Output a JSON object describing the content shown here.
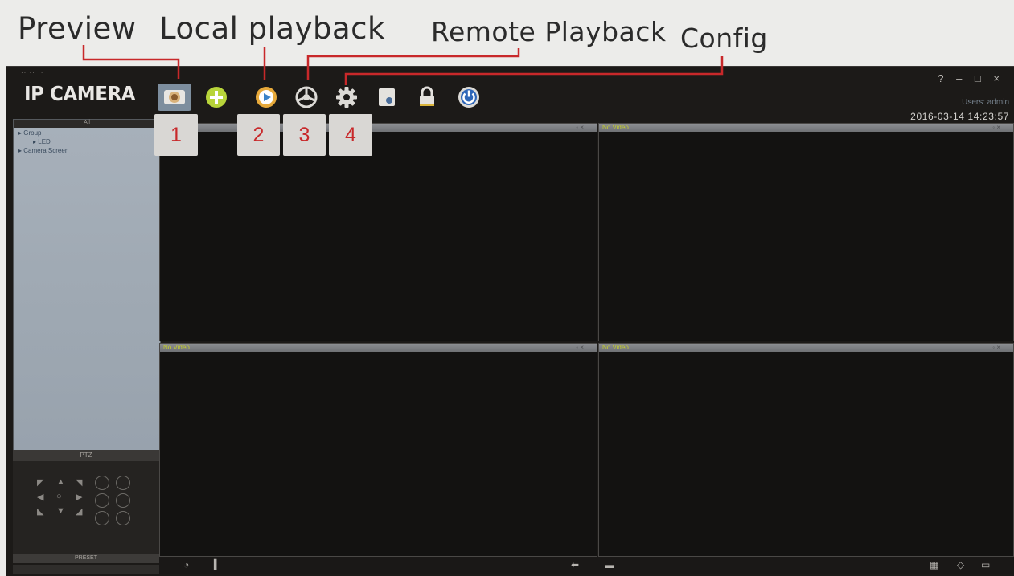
{
  "annotations": {
    "preview": "Preview",
    "local_playback": "Local playback",
    "remote_playback": "Remote Playback",
    "config": "Config"
  },
  "app": {
    "logo": "IP CAMERA",
    "datetime": "2016-03-14 14:23:57",
    "users": "Users: admin",
    "window_controls": "? – □ ×"
  },
  "toolbar": {
    "items": [
      {
        "icon": "preview-icon"
      },
      {
        "icon": "add-device-icon"
      },
      {
        "icon": "local-playback-icon"
      },
      {
        "icon": "remote-playback-icon"
      },
      {
        "icon": "config-gear-icon"
      },
      {
        "icon": "device-icon"
      },
      {
        "icon": "lock-icon"
      },
      {
        "icon": "power-icon"
      }
    ]
  },
  "badges": [
    "1",
    "2",
    "3",
    "4"
  ],
  "sidebar": {
    "header": "All",
    "tree": [
      "Group",
      "LED",
      "Camera Screen"
    ]
  },
  "ptz": {
    "title": "PTZ",
    "preset": "PRESET"
  },
  "tiles": [
    {
      "label": ""
    },
    {
      "label": "No Video"
    },
    {
      "label": "No Video"
    },
    {
      "label": "No Video"
    }
  ],
  "colors": {
    "badge_text": "#c8282a",
    "tile_label": "#c6cf2d",
    "background": "#1c1a18"
  }
}
